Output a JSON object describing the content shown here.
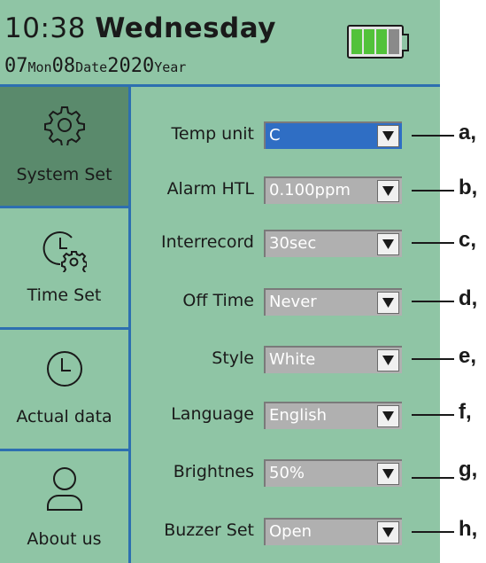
{
  "header": {
    "time": "10:38",
    "day": "Wednesday",
    "date": {
      "month_value": "07",
      "month_label": "Mon",
      "day_value": "08",
      "day_label": "Date",
      "year_value": "2020",
      "year_label": "Year"
    },
    "battery": {
      "level_fraction": 0.75,
      "colors": {
        "charged": "#52c23a",
        "empty": "#8a8a8a"
      }
    }
  },
  "sidebar": {
    "items": [
      {
        "label": "System Set",
        "icon": "gear-icon",
        "active": true
      },
      {
        "label": "Time Set",
        "icon": "clock-gear-icon",
        "active": false
      },
      {
        "label": "Actual data",
        "icon": "clock-icon",
        "active": false
      },
      {
        "label": "About us",
        "icon": "user-icon",
        "active": false
      }
    ]
  },
  "settings": [
    {
      "label": "Temp unit",
      "value": "C",
      "callout": "a,"
    },
    {
      "label": "Alarm HTL",
      "value": "0.100ppm",
      "callout": "b,"
    },
    {
      "label": "Interrecord",
      "value": "30sec",
      "callout": "c,"
    },
    {
      "label": "Off Time",
      "value": "Never",
      "callout": "d,"
    },
    {
      "label": "Style",
      "value": "White",
      "callout": "e,"
    },
    {
      "label": "Language",
      "value": "English",
      "callout": "f,"
    },
    {
      "label": "Brightnes",
      "value": "50%",
      "callout": "g,"
    },
    {
      "label": "Buzzer Set",
      "value": "Open",
      "callout": "h,"
    }
  ],
  "colors": {
    "screen_bg": "#8fc5a5",
    "divider_blue": "#2d6fb0",
    "active_sidebar": "#5a8a6c",
    "select_bg": "#b0b0b0",
    "select_focused": "#2f6ec4"
  }
}
